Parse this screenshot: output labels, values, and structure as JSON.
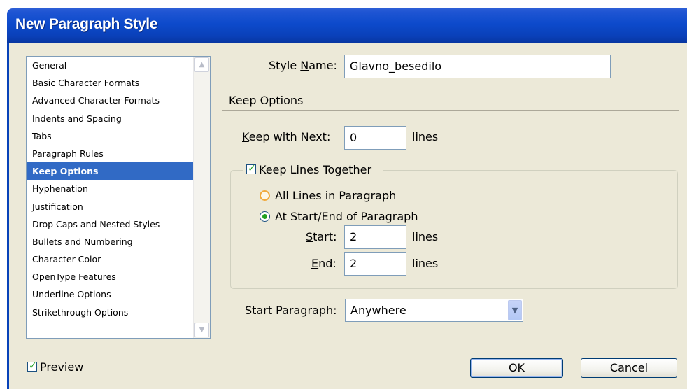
{
  "window": {
    "title": "New Paragraph Style"
  },
  "sidebar": {
    "items": [
      {
        "label": "General"
      },
      {
        "label": "Basic Character Formats"
      },
      {
        "label": "Advanced Character Formats"
      },
      {
        "label": "Indents and Spacing"
      },
      {
        "label": "Tabs"
      },
      {
        "label": "Paragraph Rules"
      },
      {
        "label": "Keep Options",
        "selected": true
      },
      {
        "label": "Hyphenation"
      },
      {
        "label": "Justification"
      },
      {
        "label": "Drop Caps and Nested Styles"
      },
      {
        "label": "Bullets and Numbering"
      },
      {
        "label": "Character Color"
      },
      {
        "label": "OpenType Features"
      },
      {
        "label": "Underline Options"
      },
      {
        "label": "Strikethrough Options"
      }
    ]
  },
  "style_name": {
    "label_pre": "Style ",
    "label_u": "N",
    "label_post": "ame:",
    "value": "Glavno_besedilo"
  },
  "section": {
    "title": "Keep Options"
  },
  "keep_with_next": {
    "label_u": "K",
    "label_post": "eep with Next:",
    "value": "0",
    "unit": "lines"
  },
  "keep_lines_together": {
    "label": "Keep Lines Together",
    "checked": true
  },
  "options": {
    "all_lines": {
      "label": "All Lines in Paragraph",
      "selected": false
    },
    "start_end": {
      "label": "At Start/End of Paragraph",
      "selected": true
    }
  },
  "start": {
    "label_u": "S",
    "label_post": "tart:",
    "value": "2",
    "unit": "lines"
  },
  "end": {
    "label_u": "E",
    "label_post": "nd:",
    "value": "2",
    "unit": "lines"
  },
  "start_paragraph": {
    "label": "Start Paragraph:",
    "value": "Anywhere"
  },
  "preview": {
    "label": "Preview",
    "checked": true
  },
  "buttons": {
    "ok": "OK",
    "cancel": "Cancel"
  },
  "colors": {
    "title_bar": "#0a46c4",
    "dialog_bg": "#ece9d8",
    "selection": "#316ac5",
    "check": "#21a121"
  }
}
